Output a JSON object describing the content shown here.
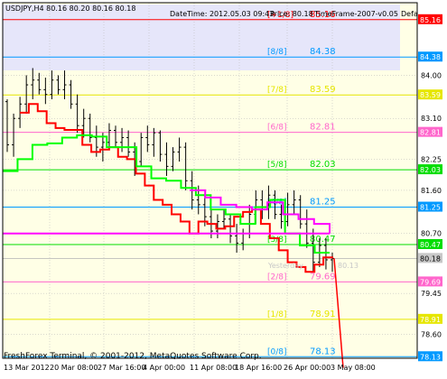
{
  "colors": {
    "chart_bg": "#ffffe6",
    "panel_bg": "#ffffff",
    "highlight_band": "#e6e6fa",
    "frame": "#000000",
    "grid": "#b4b4b4",
    "text": "#000000",
    "price_bars": "#000000",
    "trend_red": "#ff0000",
    "trend_green": "#00ff00",
    "trend_magenta": "#ff00ff"
  },
  "header": {
    "symbol_text": "USDJPY,H4  80.16 80.20 80.16 80.18",
    "datetime_text": "DateTime: 2012.05.03 09:43",
    "price_text": "Price: 80.18",
    "timeframe_text": "TimeFrame-2007-v0.05",
    "defa_text": "Defa"
  },
  "footer": {
    "copyright": "FreshForex Terminal, © 2001-2012, MetaQuotes Software Corp."
  },
  "chart_data": {
    "type": "candlestick",
    "symbol": "USDJPY",
    "timeframe": "H4",
    "ylim": [
      77.74,
      85.57
    ],
    "y_ticks": [
      84.0,
      83.1,
      82.25,
      81.6,
      80.7,
      79.45,
      78.6
    ],
    "x_ticks": [
      "13 Mar 2012",
      "20 Mar 08:00",
      "27 Mar 16:00",
      "4 Apr 00:00",
      "11 Apr 08:00",
      "18 Apr 16:00",
      "26 Apr 00:00",
      "3 May 08:00"
    ],
    "murrey_levels": [
      {
        "label": "[+1/8]",
        "value": 85.16,
        "color": "#ff0000"
      },
      {
        "label": "[8/8]",
        "value": 84.38,
        "color": "#0099ff"
      },
      {
        "label": "[7/8]",
        "value": 83.59,
        "color": "#e6e600"
      },
      {
        "label": "[6/8]",
        "value": 82.81,
        "color": "#ff66cc"
      },
      {
        "label": "[5/8]",
        "value": 82.03,
        "color": "#00dd00"
      },
      {
        "label": "[4/8]",
        "value": 81.25,
        "color": "#0099ff"
      },
      {
        "label": "[3/8]",
        "value": 80.47,
        "color": "#00dd00"
      },
      {
        "label": "[2/8]",
        "value": 79.69,
        "color": "#ff66cc"
      },
      {
        "label": "[1/8]",
        "value": 78.91,
        "color": "#e6e600"
      },
      {
        "label": "[0/8]",
        "value": 78.13,
        "color": "#0099ff"
      }
    ],
    "last_price": 80.18,
    "extra_scale_labels": [
      "80.18",
      "80.1?"
    ],
    "magenta_level": {
      "value": 80.7
    },
    "yesterday_label": "Yesterday",
    "yesterday_value_label": "80.13",
    "red_projection": {
      "from": 80.18,
      "to": 77.9
    },
    "red_trend": [
      83.22,
      83.4,
      83.25,
      83.0,
      82.9,
      82.86,
      82.86,
      82.55,
      82.4,
      82.45,
      82.5,
      82.3,
      82.25,
      81.95,
      81.7,
      81.4,
      81.3,
      81.1,
      80.95,
      80.7,
      80.95,
      80.9,
      80.8,
      80.85,
      81.05,
      81.15,
      81.2,
      80.9,
      80.6,
      80.35,
      80.1,
      80.0,
      79.9,
      80.05,
      80.2,
      80.18
    ],
    "green_trend": [
      82.0,
      82.25,
      82.55,
      82.58,
      82.7,
      82.75,
      82.72,
      82.5,
      82.5,
      82.1,
      81.85,
      81.8,
      81.65,
      81.5,
      81.2,
      81.1,
      80.9,
      81.25,
      81.4,
      80.7,
      80.45,
      80.3,
      80.3
    ],
    "magenta_trend": [
      81.6,
      81.45,
      81.3,
      81.25,
      81.2,
      81.35,
      81.1,
      81.0,
      80.9,
      80.7
    ],
    "candles": [
      [
        83.45,
        83.5,
        82.4,
        82.55
      ],
      [
        82.55,
        83.2,
        82.3,
        83.1
      ],
      [
        83.1,
        83.55,
        82.9,
        83.4
      ],
      [
        83.4,
        84.0,
        83.2,
        83.8
      ],
      [
        83.8,
        84.15,
        83.5,
        83.9
      ],
      [
        83.9,
        84.05,
        83.6,
        83.7
      ],
      [
        83.7,
        83.95,
        83.4,
        83.6
      ],
      [
        83.6,
        84.1,
        83.5,
        83.9
      ],
      [
        83.9,
        84.0,
        83.6,
        83.7
      ],
      [
        83.7,
        84.1,
        83.5,
        83.8
      ],
      [
        83.8,
        83.9,
        83.3,
        83.4
      ],
      [
        83.4,
        83.6,
        82.8,
        82.95
      ],
      [
        82.95,
        83.3,
        82.7,
        83.1
      ],
      [
        83.1,
        83.2,
        82.6,
        82.7
      ],
      [
        82.7,
        82.95,
        82.3,
        82.5
      ],
      [
        82.5,
        82.8,
        82.2,
        82.6
      ],
      [
        82.6,
        83.0,
        82.5,
        82.85
      ],
      [
        82.85,
        82.95,
        82.5,
        82.6
      ],
      [
        82.6,
        82.9,
        82.4,
        82.7
      ],
      [
        82.7,
        82.85,
        82.3,
        82.4
      ],
      [
        82.4,
        82.6,
        81.9,
        82.2
      ],
      [
        82.2,
        82.8,
        82.1,
        82.7
      ],
      [
        82.7,
        82.95,
        82.4,
        82.55
      ],
      [
        82.55,
        82.9,
        82.3,
        82.8
      ],
      [
        82.8,
        82.85,
        82.2,
        82.35
      ],
      [
        82.35,
        82.6,
        81.9,
        82.1
      ],
      [
        82.1,
        82.5,
        82.0,
        82.4
      ],
      [
        82.4,
        82.7,
        82.2,
        82.5
      ],
      [
        82.5,
        82.6,
        81.6,
        81.8
      ],
      [
        81.8,
        82.0,
        81.2,
        81.4
      ],
      [
        81.4,
        81.7,
        81.1,
        81.3
      ],
      [
        81.3,
        81.5,
        80.85,
        81.05
      ],
      [
        81.05,
        81.2,
        80.6,
        80.75
      ],
      [
        80.75,
        81.1,
        80.6,
        80.95
      ],
      [
        80.95,
        81.2,
        80.8,
        81.0
      ],
      [
        81.0,
        81.1,
        80.5,
        80.65
      ],
      [
        80.65,
        80.9,
        80.3,
        80.5
      ],
      [
        80.5,
        80.8,
        80.35,
        80.7
      ],
      [
        80.7,
        81.3,
        80.6,
        81.1
      ],
      [
        81.1,
        81.6,
        80.9,
        81.4
      ],
      [
        81.4,
        81.6,
        81.0,
        81.2
      ],
      [
        81.2,
        81.7,
        81.0,
        81.5
      ],
      [
        81.5,
        81.6,
        81.0,
        81.1
      ],
      [
        81.1,
        81.3,
        80.8,
        80.95
      ],
      [
        80.95,
        81.55,
        80.85,
        81.3
      ],
      [
        81.3,
        81.6,
        81.1,
        81.4
      ],
      [
        81.4,
        81.5,
        80.8,
        80.9
      ],
      [
        80.9,
        81.2,
        80.4,
        80.5
      ],
      [
        80.5,
        80.8,
        79.9,
        80.1
      ],
      [
        80.1,
        80.6,
        80.0,
        80.45
      ],
      [
        80.45,
        80.6,
        79.95,
        80.15
      ],
      [
        80.15,
        80.3,
        79.9,
        80.18
      ]
    ]
  }
}
